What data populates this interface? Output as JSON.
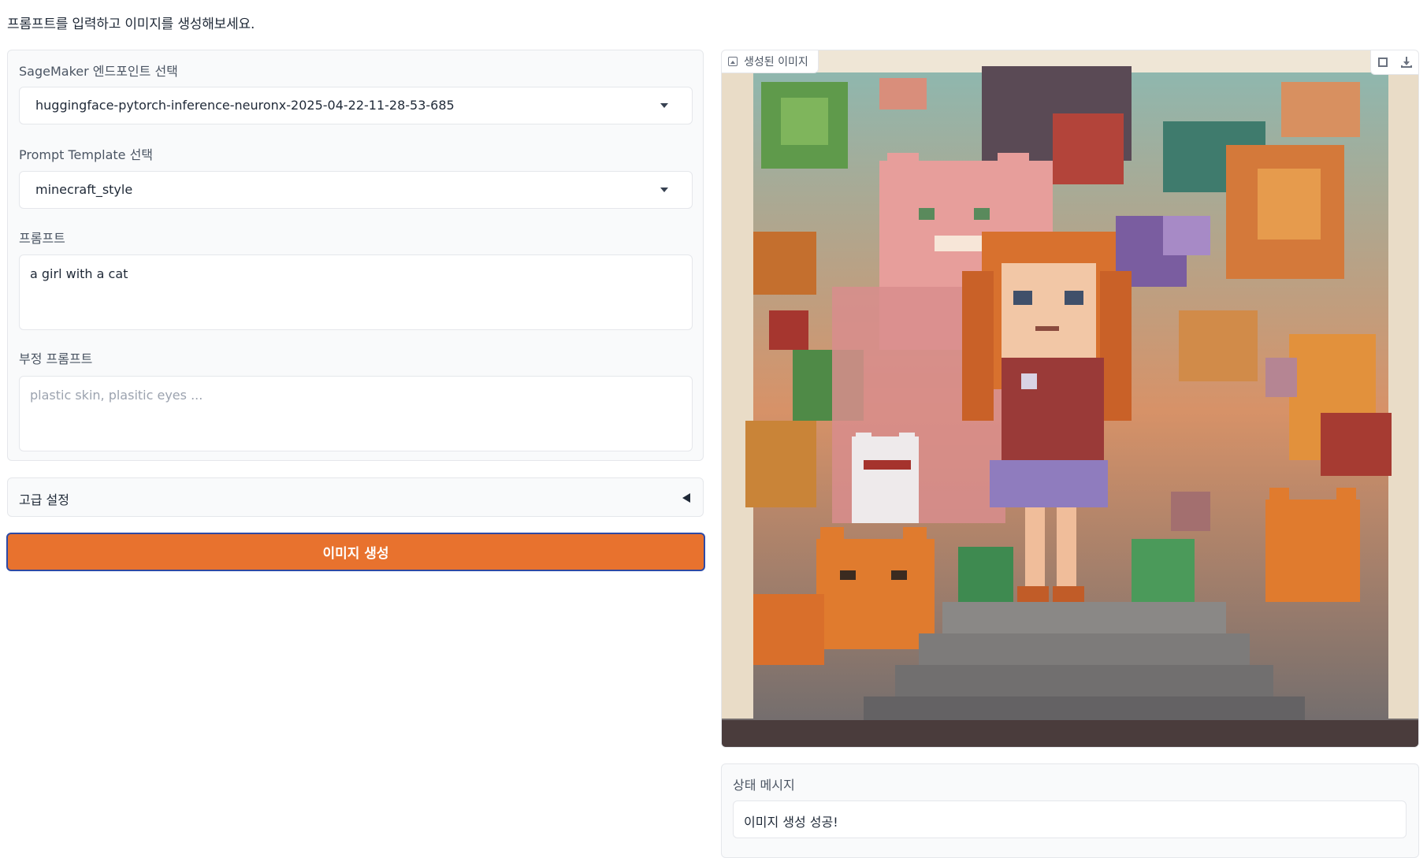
{
  "intro_text": "프롬프트를 입력하고 이미지를 생성해보세요.",
  "form": {
    "endpoint": {
      "label": "SageMaker 엔드포인트 선택",
      "selected": "huggingface-pytorch-inference-neuronx-2025-04-22-11-28-53-685"
    },
    "template": {
      "label": "Prompt Template 선택",
      "selected": "minecraft_style"
    },
    "prompt": {
      "label": "프롬프트",
      "value": "a girl with a cat"
    },
    "negative_prompt": {
      "label": "부정 프롬프트",
      "value": "",
      "placeholder": "plastic skin, plasitic eyes ..."
    }
  },
  "advanced": {
    "label": "고급 설정"
  },
  "generate_button": {
    "label": "이미지 생성"
  },
  "output_image": {
    "label": "생성된 이미지",
    "icons": [
      "fullscreen-icon",
      "download-icon"
    ]
  },
  "status": {
    "label": "상태 메시지",
    "value": "이미지 생성 성공!"
  },
  "colors": {
    "accent": "#e8722e",
    "focus_border": "#2d4aa5"
  }
}
